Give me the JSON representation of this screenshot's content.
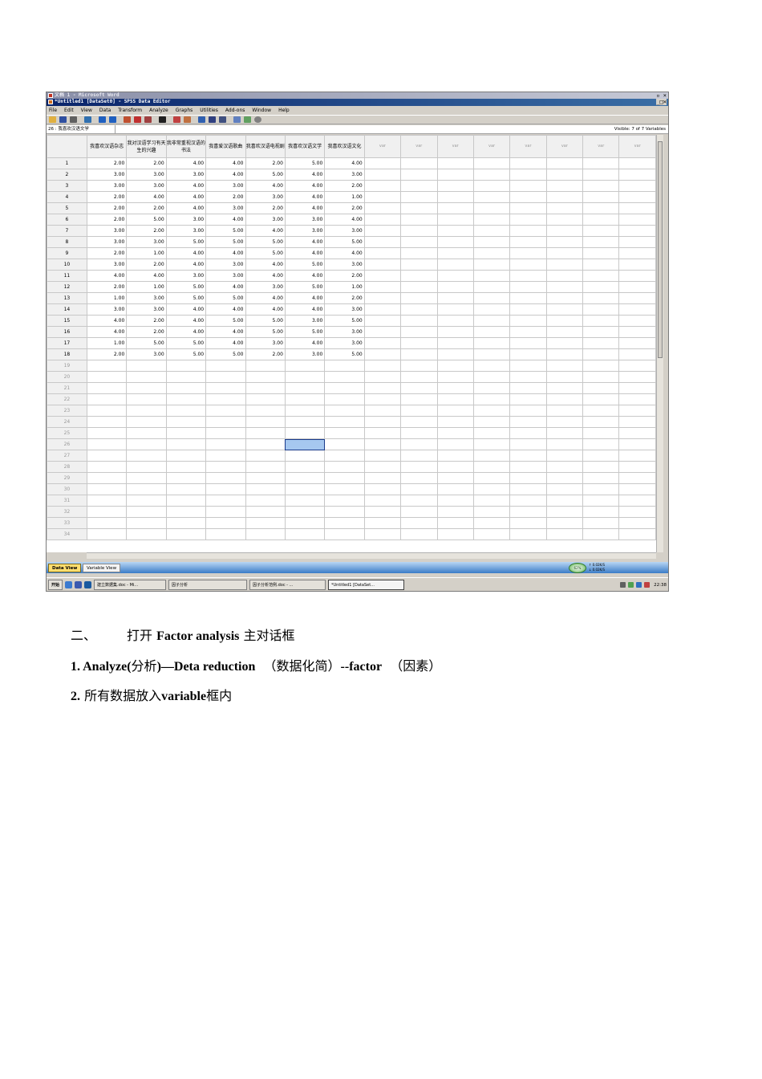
{
  "screenshot": {
    "background_title": "文档 1 - Microsoft Word",
    "window_title": "*Untitled1 [DataSet0] - SPSS Data Editor",
    "window_buttons": "_□×",
    "menu": [
      "File",
      "Edit",
      "View",
      "Data",
      "Transform",
      "Analyze",
      "Graphs",
      "Utilities",
      "Add-ons",
      "Window",
      "Help"
    ],
    "toolbar_icons": [
      "open-icon",
      "save-icon",
      "print-icon",
      "dialog-recall-icon",
      "undo-icon",
      "redo-icon",
      "goto-case-icon",
      "variables-icon",
      "insert-variable-icon",
      "find-icon",
      "insert-cases-icon",
      "split-file-icon",
      "weight-icon",
      "select-cases-icon",
      "value-labels-icon",
      "use-sets-icon",
      "show-all-icon",
      "spelling-icon"
    ],
    "cell_ref": "26 : 我喜欢汉语文学",
    "visible_label": "Visible: 7 of 7 Variables",
    "columns": [
      "我喜欢汉语杂志",
      "我对汉语学习有天生的兴趣",
      "我非常重视汉语的书法",
      "我喜爱汉语歌曲",
      "我喜欢汉语电视剧",
      "我喜欢汉语文学",
      "我喜欢汉语文化"
    ],
    "empty_var_label": "var",
    "empty_var_count": 8,
    "rows": [
      [
        "2.00",
        "2.00",
        "4.00",
        "4.00",
        "2.00",
        "5.00",
        "4.00"
      ],
      [
        "3.00",
        "3.00",
        "3.00",
        "4.00",
        "5.00",
        "4.00",
        "3.00"
      ],
      [
        "3.00",
        "3.00",
        "4.00",
        "3.00",
        "4.00",
        "4.00",
        "2.00"
      ],
      [
        "2.00",
        "4.00",
        "4.00",
        "2.00",
        "3.00",
        "4.00",
        "1.00"
      ],
      [
        "2.00",
        "2.00",
        "4.00",
        "3.00",
        "2.00",
        "4.00",
        "2.00"
      ],
      [
        "2.00",
        "5.00",
        "3.00",
        "4.00",
        "3.00",
        "3.00",
        "4.00"
      ],
      [
        "3.00",
        "2.00",
        "3.00",
        "5.00",
        "4.00",
        "3.00",
        "3.00"
      ],
      [
        "3.00",
        "3.00",
        "5.00",
        "5.00",
        "5.00",
        "4.00",
        "5.00"
      ],
      [
        "2.00",
        "1.00",
        "4.00",
        "4.00",
        "5.00",
        "4.00",
        "4.00"
      ],
      [
        "3.00",
        "2.00",
        "4.00",
        "3.00",
        "4.00",
        "5.00",
        "3.00"
      ],
      [
        "4.00",
        "4.00",
        "3.00",
        "3.00",
        "4.00",
        "4.00",
        "2.00"
      ],
      [
        "2.00",
        "1.00",
        "5.00",
        "4.00",
        "3.00",
        "5.00",
        "1.00"
      ],
      [
        "1.00",
        "3.00",
        "5.00",
        "5.00",
        "4.00",
        "4.00",
        "2.00"
      ],
      [
        "3.00",
        "3.00",
        "4.00",
        "4.00",
        "4.00",
        "4.00",
        "3.00"
      ],
      [
        "4.00",
        "2.00",
        "4.00",
        "5.00",
        "5.00",
        "3.00",
        "5.00"
      ],
      [
        "4.00",
        "2.00",
        "4.00",
        "4.00",
        "5.00",
        "5.00",
        "3.00"
      ],
      [
        "1.00",
        "5.00",
        "5.00",
        "4.00",
        "3.00",
        "4.00",
        "3.00"
      ],
      [
        "2.00",
        "3.00",
        "5.00",
        "5.00",
        "2.00",
        "3.00",
        "5.00"
      ]
    ],
    "total_visible_rows": 34,
    "selected_cell": {
      "row": 26,
      "col": 6
    },
    "view_tabs": {
      "data": "Data View",
      "variable": "Variable View"
    },
    "network_gauge": {
      "percent": "62%",
      "up": "↑ 0.02K/S",
      "down": "↓ 0.02K/S"
    },
    "taskbar": {
      "start": "开始",
      "tasks": [
        "建立数据集.doc - Mi...",
        "因子分析",
        "因子分析范例.doc - ...",
        "*Untitled1 [DataSet..."
      ],
      "clock": "22:38"
    },
    "colors": {
      "title_active": "#0a246a",
      "tabs_bar": "#3b7cc7",
      "selected_cell": "#a6c8f0"
    }
  },
  "document": {
    "heading_num": "二、",
    "heading_pre": "打开",
    "heading_bold": "Factor analysis",
    "heading_post": "主对话框",
    "step1_bold_a": "1. Analyze(",
    "step1_cn_a": "分析",
    "step1_bold_b": ")—Deta reduction",
    "step1_cn_b": "（数据化简）",
    "step1_bold_c": "--factor",
    "step1_cn_c": "（因素）",
    "step2_bold_a": "2.",
    "step2_cn_a": "所有数据放入",
    "step2_bold_b": "variable",
    "step2_cn_b": "框内"
  }
}
